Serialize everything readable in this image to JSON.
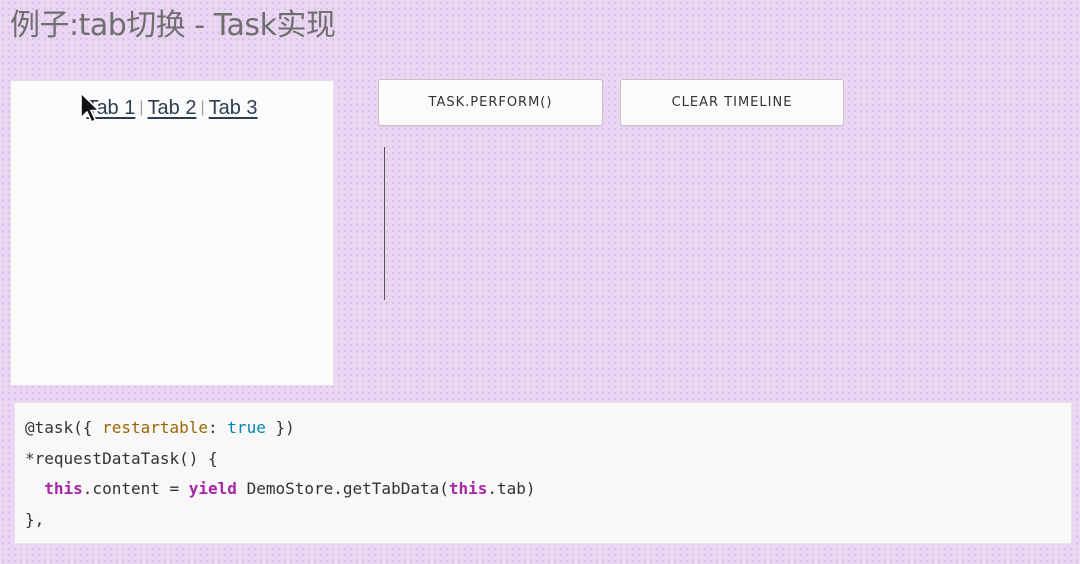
{
  "page": {
    "title": "例子:tab切换 - Task实现",
    "background_color": "#ead6f3"
  },
  "tabs": {
    "items": [
      {
        "label": "Tab 1"
      },
      {
        "label": "Tab 2"
      },
      {
        "label": "Tab 3"
      }
    ],
    "separator": "|"
  },
  "toolbar": {
    "perform_label": "TASK.PERFORM()",
    "clear_label": "CLEAR TIMELINE"
  },
  "code": {
    "line1": {
      "prefix": "@task({ ",
      "attr": "restartable",
      "colon": ": ",
      "bool": "true",
      "suffix": " })"
    },
    "line2": {
      "text": "*requestDataTask() {"
    },
    "line3": {
      "indent": "  ",
      "kw1": "this",
      "mid1": ".content = ",
      "kw2": "yield",
      "mid2": " DemoStore.getTabData(",
      "kw3": "this",
      "suffix": ".tab)"
    },
    "line4": {
      "text": "},"
    }
  },
  "colors": {
    "code_attr": "#986801",
    "code_bool": "#0086b3",
    "code_keyword": "#a626a4"
  },
  "icons": {
    "cursor": "mouse-pointer-icon"
  }
}
